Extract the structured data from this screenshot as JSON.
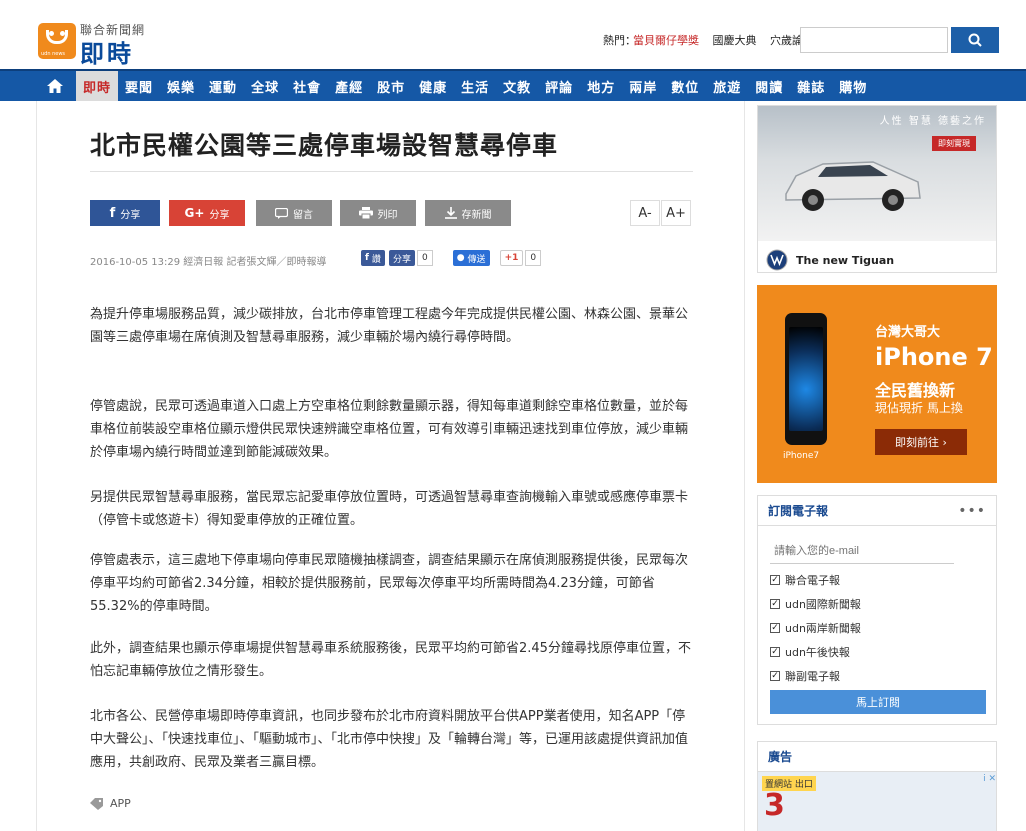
{
  "header": {
    "brand_top": "聯合新聞網",
    "brand_main": "即時",
    "logo_mini": "udn news",
    "hot_label": "熱門：",
    "hot_links": [
      "當貝爾仔學獎",
      "國慶大典",
      "穴歲論"
    ],
    "search_placeholder": ""
  },
  "nav": {
    "items": [
      "即時",
      "要聞",
      "娛樂",
      "運動",
      "全球",
      "社會",
      "產經",
      "股市",
      "健康",
      "生活",
      "文教",
      "評論",
      "地方",
      "兩岸",
      "數位",
      "旅遊",
      "閱讀",
      "雜誌",
      "購物"
    ],
    "active_index": 0
  },
  "article": {
    "title": "北市民權公園等三處停車場設智慧尋停車",
    "share": {
      "facebook": "分享",
      "google": "分享",
      "comment": "留言",
      "print": "列印",
      "save": "存新聞"
    },
    "font_minus": "A-",
    "font_plus": "A+",
    "meta": "2016-10-05 13:29 經濟日報 記者張文輝／即時報導",
    "mini": {
      "fb_label": "讚",
      "share_label": "分享",
      "share_count": "0",
      "message_label": "傳送",
      "gplus_label": "+1",
      "gplus_count": "0"
    },
    "paragraphs": [
      "為提升停車場服務品質，減少碳排放，台北市停車管理工程處今年完成提供民權公園、林森公園、景華公園等三處停車場在席偵測及智慧尋車服務，減少車輛於場內繞行尋停時間。",
      "停管處說，民眾可透過車道入口處上方空車格位剩餘數量顯示器，得知每車道剩餘空車格位數量，並於每車格位前裝設空車格位顯示燈供民眾快速辨識空車格位置，可有效導引車輛迅速找到車位停放，減少車輛於停車場內繞行時間並達到節能減碳效果。",
      "另提供民眾智慧尋車服務，當民眾忘記愛車停放位置時，可透過智慧尋車查詢機輸入車號或感應停車票卡（停管卡或悠遊卡）得知愛車停放的正確位置。",
      "停管處表示，這三處地下停車場向停車民眾隨機抽樣調查，調查結果顯示在席偵測服務提供後，民眾每次停車平均約可節省2.34分鐘，相較於提供服務前，民眾每次停車平均所需時間為4.23分鐘，可節省55.32%的停車時間。",
      "此外，調查結果也顯示停車場提供智慧尋車系統服務後，民眾平均約可節省2.45分鐘尋找原停車位置，不怕忘記車輛停放位之情形發生。",
      "北市各公、民營停車場即時停車資訊，也同步發布於北市府資料開放平台供APP業者使用，知名APP「停中大聲公」、「快速找車位」、「驅動城市」、「北市停中快搜」及「輪轉台灣」等，已運用該處提供資訊加值應用，共創政府、民眾及業者三贏目標。"
    ],
    "tag": "APP"
  },
  "ads": {
    "vw": {
      "tagline": "人性 智慧 德藝之作",
      "cta": "即刻實現",
      "footer": "The new Tiguan"
    },
    "iphone": {
      "brand": "台灣大哥大",
      "title": "iPhone 7",
      "sub1": "全民舊換新",
      "sub2": "現佔現折 馬上換",
      "button": "即刻前往 ›",
      "mini": "iPhone7"
    }
  },
  "subscribe": {
    "title": "訂閱電子報",
    "dots": "•••",
    "email_placeholder": "請輸入您的e-mail",
    "options": [
      "聯合電子報",
      "udn國際新聞報",
      "udn兩岸新聞報",
      "udn午後快報",
      "聯副電子報"
    ],
    "button": "馬上訂閱"
  },
  "adbox": {
    "title": "廣告",
    "chip": "置網站 出口",
    "num": "3",
    "info": "i ✕"
  },
  "colors": {
    "nav_blue": "#1558a6",
    "accent_red": "#c62828",
    "orange": "#f08a1c"
  }
}
